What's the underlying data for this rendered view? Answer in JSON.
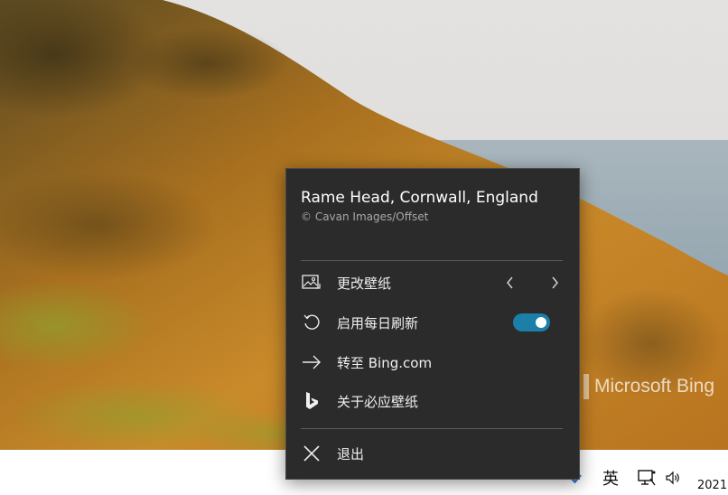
{
  "wallpaper": {
    "watermark_text": "Microsoft Bing"
  },
  "popup": {
    "title": "Rame Head, Cornwall, England",
    "credit": "© Cavan Images/Offset",
    "items": [
      {
        "label": "更改壁纸",
        "icon": "image-swap-icon"
      },
      {
        "label": "启用每日刷新",
        "icon": "refresh-icon",
        "toggle_on": true
      },
      {
        "label": "转至 Bing.com",
        "icon": "arrow-right-icon"
      },
      {
        "label": "关于必应壁纸",
        "icon": "bing-logo-icon"
      },
      {
        "label": "退出",
        "icon": "close-icon"
      }
    ],
    "accent_color": "#1b7fa8"
  },
  "taskbar": {
    "ime_label": "英",
    "clock_text": "2021"
  }
}
